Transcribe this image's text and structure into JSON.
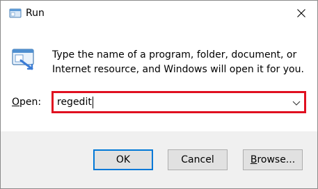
{
  "window": {
    "title": "Run",
    "icon": "run-dialog-icon"
  },
  "dialog": {
    "description": "Type the name of a program, folder, document, or Internet resource, and Windows will open it for you.",
    "open_label_prefix": "O",
    "open_label_rest": "pen:",
    "open_value": "regedit"
  },
  "buttons": {
    "ok": "OK",
    "cancel": "Cancel",
    "browse_prefix": "B",
    "browse_rest": "rowse..."
  },
  "colors": {
    "highlight_border": "#e01020",
    "ok_border": "#0078d7",
    "footer_bg": "#f0f0f0"
  }
}
